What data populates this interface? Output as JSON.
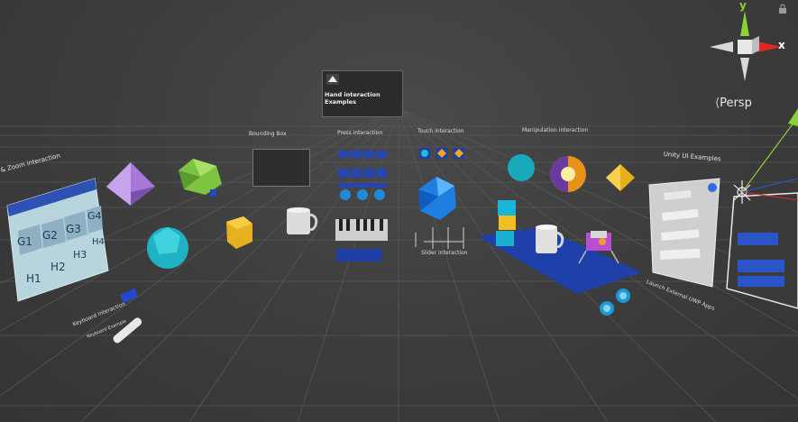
{
  "gizmo": {
    "y_axis": "y",
    "x_axis": "x",
    "projection": "Persp"
  },
  "labels": {
    "hand_interaction_title": "Hand interaction Examples",
    "bounding_box": "Bounding Box",
    "press_interaction": "Press interaction",
    "touch_interaction": "Touch interaction",
    "manipulation_interaction": "Manipulation interaction",
    "unity_ui_examples": "Unity UI Examples",
    "pan_zoom_interaction": "& Zoom interaction",
    "keyboard_interaction": "Keyboard interaction",
    "keyboard_sub": "Keyboard Example",
    "slider_interaction": "Slider interaction",
    "launch_apps": "Launch External UWP Apps"
  },
  "tiles": {
    "row1": [
      "G1",
      "G2",
      "G3",
      "G4"
    ],
    "row2": [
      "H1",
      "H2",
      "H3",
      "H4"
    ]
  },
  "colors": {
    "background": "#3a3a3a",
    "grid": "#555555",
    "y_axis": "#8bd135",
    "x_axis": "#e0281e",
    "z_axis": "#2f5bd6",
    "accent_blue": "#1e3fa8"
  }
}
